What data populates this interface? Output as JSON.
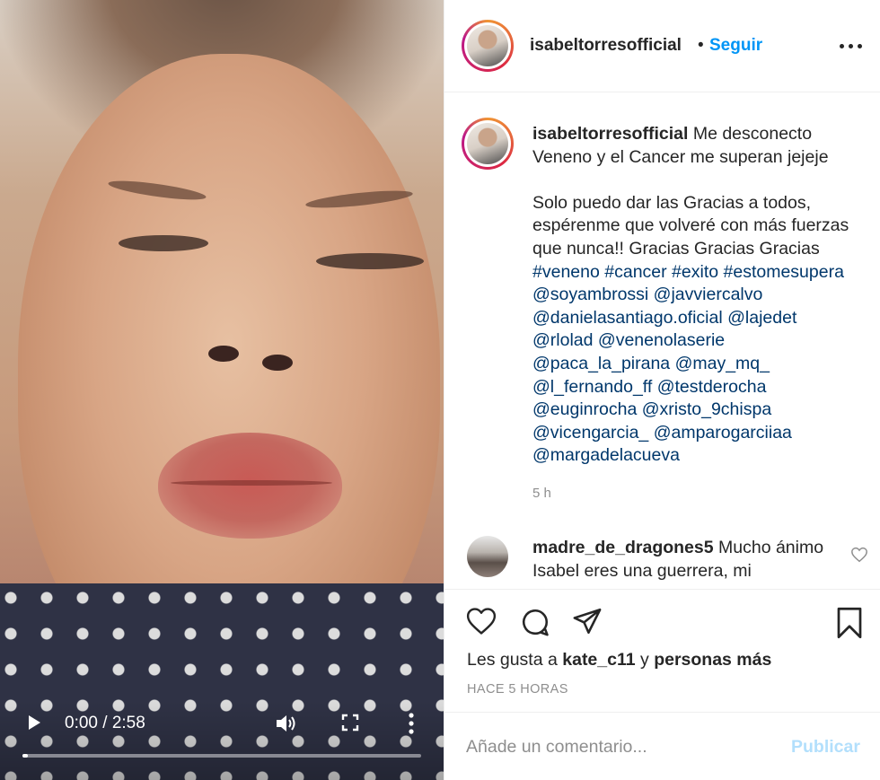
{
  "video": {
    "time_display": "0:00 / 2:58",
    "progress_fraction": 0.0,
    "icons": [
      "play-icon",
      "volume-icon",
      "fullscreen-icon",
      "more-vertical-icon"
    ]
  },
  "header": {
    "username": "isabeltorresofficial",
    "separator": "•",
    "follow_label": "Seguir",
    "options_icon": "more-horizontal-icon"
  },
  "caption": {
    "username": "isabeltorresofficial",
    "line1": " Me desconecto Veneno y el Cancer me superan jejeje",
    "line2": "Solo puedo dar las Gracias a todos, espérenme que volveré con más fuerzas que nunca!! Gracias Gracias Gracias",
    "hashtags": [
      "#veneno",
      "#cancer",
      "#exito",
      "#estomesupera"
    ],
    "mentions": [
      "@soyambrossi",
      "@javviercalvo",
      "@danielasantiago.oficial",
      "@lajedet",
      "@rlolad",
      "@venenolaserie",
      "@paca_la_pirana",
      "@may_mq_",
      "@l_fernando_ff",
      "@testderocha",
      "@euginrocha",
      "@xristo_9chispa",
      "@vicengarcia_",
      "@amparogarciiaa",
      "@margadelacueva"
    ],
    "age": "5 h"
  },
  "comment": {
    "username": "madre_de_dragones5",
    "text": " Mucho ánimo Isabel eres una guerrera, mi"
  },
  "actions": {
    "icons": [
      "heart-icon",
      "comment-bubble-icon",
      "share-icon",
      "bookmark-icon"
    ],
    "likes_prefix": "Les gusta a ",
    "likes_user": "kate_c11",
    "likes_middle": " y ",
    "likes_suffix": "personas más",
    "timestamp": "HACE 5 HORAS"
  },
  "add_comment": {
    "placeholder": "Añade un comentario...",
    "publish_label": "Publicar"
  },
  "colors": {
    "accent_blue": "#0095f6",
    "link_blue": "#00376b",
    "publish_disabled": "#b2dffc",
    "muted_gray": "#8e8e8e"
  }
}
